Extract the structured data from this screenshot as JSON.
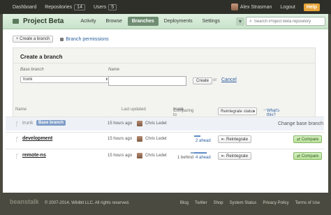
{
  "topbar": {
    "dashboard": "Dashboard",
    "repositories": "Repositories",
    "repositories_count": "14",
    "users": "Users",
    "users_count": "5",
    "user_name": "Alex Strasman",
    "logout": "Logout",
    "help": "Help"
  },
  "project": {
    "title": "Project Beta",
    "tabs": [
      "Activity",
      "Browse",
      "Branches",
      "Deployments",
      "Settings"
    ],
    "active_tab": "Branches",
    "search_placeholder": "Search Project Beta repository"
  },
  "actions": {
    "create_branch": "+ Create a branch",
    "branch_permissions": "Branch permissions"
  },
  "create_form": {
    "title": "Create a branch",
    "base_label": "Base branch",
    "base_value": "trunk",
    "name_label": "Name",
    "create_button": "Create",
    "or": "or",
    "cancel": "Cancel"
  },
  "table": {
    "col_name": "Name",
    "col_updated": "Last updated",
    "col_comparing": "Comparing to",
    "comparing_branch": "trunk",
    "sort_select": "Reintegrate status",
    "whats_this": "What's this?",
    "rows": [
      {
        "name": "trunk",
        "badge": "Base branch",
        "ago": "15 hours ago",
        "user": "Chris Ledet",
        "action": "Change base branch"
      },
      {
        "name": "development",
        "ago": "15 hours ago",
        "user": "Chris Ledet",
        "behind": "",
        "ahead": "2 ahead",
        "behind_frac": 0,
        "ahead_frac": 0.5,
        "reintegrate": "Reintegrate",
        "compare": "Compare"
      },
      {
        "name": "remote-ns",
        "ago": "15 hours ago",
        "user": "Chris Ledet",
        "behind": "1 behind",
        "ahead": "4 ahead",
        "behind_frac": 0.3,
        "ahead_frac": 1.0,
        "reintegrate": "Reintegrate",
        "compare": "Compare"
      }
    ]
  },
  "footer": {
    "logo": "beanstalk",
    "copyright": "© 2007-2014, Wildbit LLC. All rights reserved.",
    "links": [
      "Blog",
      "Twitter",
      "Shop",
      "System Status",
      "Privacy Policy",
      "Terms of Use"
    ]
  }
}
